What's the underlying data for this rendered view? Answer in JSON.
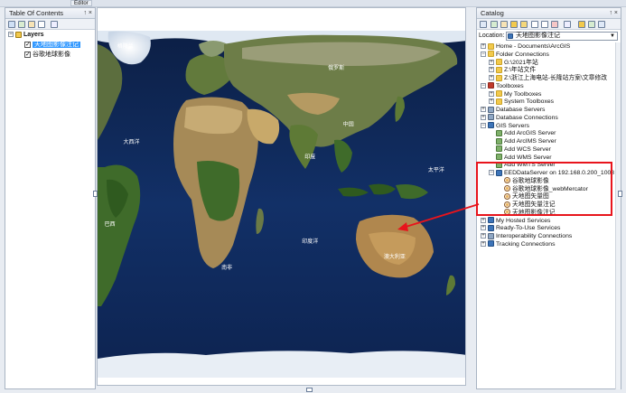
{
  "toc": {
    "title": "Table Of Contents",
    "pin_glyphs": "↑ ×",
    "layers_label": "Layers",
    "layers": [
      {
        "label": "天地图影像注记",
        "checked": true,
        "selected": true
      },
      {
        "label": "谷歌地球影像",
        "checked": true,
        "selected": false
      }
    ]
  },
  "editor_tab": "Editor",
  "catalog": {
    "title": "Catalog",
    "pin_glyphs": "↑ ×",
    "location_label": "Location:",
    "location_value": "天地图影像注记",
    "tree": [
      {
        "label": "Home - Documents\\ArcGIS",
        "depth": 0,
        "toggle": "+",
        "icon": "folder"
      },
      {
        "label": "Folder Connections",
        "depth": 0,
        "toggle": "-",
        "icon": "folder"
      },
      {
        "label": "G:\\2021年站",
        "depth": 1,
        "toggle": "+",
        "icon": "folder"
      },
      {
        "label": "Z:\\年站文件",
        "depth": 1,
        "toggle": "+",
        "icon": "folder"
      },
      {
        "label": "Z:\\浙江上海电站-长隆站方案\\文章修改",
        "depth": 1,
        "toggle": "+",
        "icon": "folder"
      },
      {
        "label": "Toolboxes",
        "depth": 0,
        "toggle": "-",
        "icon": "tool"
      },
      {
        "label": "My Toolboxes",
        "depth": 1,
        "toggle": "+",
        "icon": "folder"
      },
      {
        "label": "System Toolboxes",
        "depth": 1,
        "toggle": "+",
        "icon": "folder"
      },
      {
        "label": "Database Servers",
        "depth": 0,
        "toggle": "+",
        "icon": "db"
      },
      {
        "label": "Database Connections",
        "depth": 0,
        "toggle": "+",
        "icon": "db"
      },
      {
        "label": "GIS Servers",
        "depth": 0,
        "toggle": "-",
        "icon": "gis"
      },
      {
        "label": "Add ArcGIS Server",
        "depth": 1,
        "toggle": "",
        "icon": "add"
      },
      {
        "label": "Add ArcIMS Server",
        "depth": 1,
        "toggle": "",
        "icon": "add"
      },
      {
        "label": "Add WCS Server",
        "depth": 1,
        "toggle": "",
        "icon": "add"
      },
      {
        "label": "Add WMS Server",
        "depth": 1,
        "toggle": "",
        "icon": "add"
      },
      {
        "label": "Add WMTS Server",
        "depth": 1,
        "toggle": "",
        "icon": "add"
      },
      {
        "label": "EEDDataServer on 192.168.0.200_1008",
        "depth": 1,
        "toggle": "-",
        "icon": "gis"
      },
      {
        "label": "谷歌地球影像",
        "depth": 2,
        "toggle": "",
        "icon": "svc"
      },
      {
        "label": "谷歌地球影像_webMercator",
        "depth": 2,
        "toggle": "",
        "icon": "svc"
      },
      {
        "label": "天地图矢量图",
        "depth": 2,
        "toggle": "",
        "icon": "svc"
      },
      {
        "label": "天地图矢量注记",
        "depth": 2,
        "toggle": "",
        "icon": "svc"
      },
      {
        "label": "天地图影像注记",
        "depth": 2,
        "toggle": "",
        "icon": "svc"
      },
      {
        "label": "My Hosted Services",
        "depth": 0,
        "toggle": "+",
        "icon": "gis"
      },
      {
        "label": "Ready-To-Use Services",
        "depth": 0,
        "toggle": "+",
        "icon": "gis"
      },
      {
        "label": "Interoperability Connections",
        "depth": 0,
        "toggle": "+",
        "icon": "db"
      },
      {
        "label": "Tracking Connections",
        "depth": 0,
        "toggle": "+",
        "icon": "gis"
      }
    ]
  },
  "map": {
    "labels": [
      {
        "text": "格陵兰",
        "lon": -42,
        "lat": 72
      },
      {
        "text": "俄罗斯",
        "lon": 95,
        "lat": 62
      },
      {
        "text": "中国",
        "lon": 103,
        "lat": 36
      },
      {
        "text": "印度",
        "lon": 78,
        "lat": 21
      },
      {
        "text": "巴西",
        "lon": -52,
        "lat": -10
      },
      {
        "text": "澳大利亚",
        "lon": 133,
        "lat": -25
      },
      {
        "text": "南非",
        "lon": 24,
        "lat": -30
      },
      {
        "text": "印度洋",
        "lon": 78,
        "lat": -18
      },
      {
        "text": "太平洋",
        "lon": 160,
        "lat": 15
      },
      {
        "text": "大西洋",
        "lon": -38,
        "lat": 28
      }
    ]
  },
  "highlight_color": "#e8141c",
  "selection_color": "#3399ff"
}
